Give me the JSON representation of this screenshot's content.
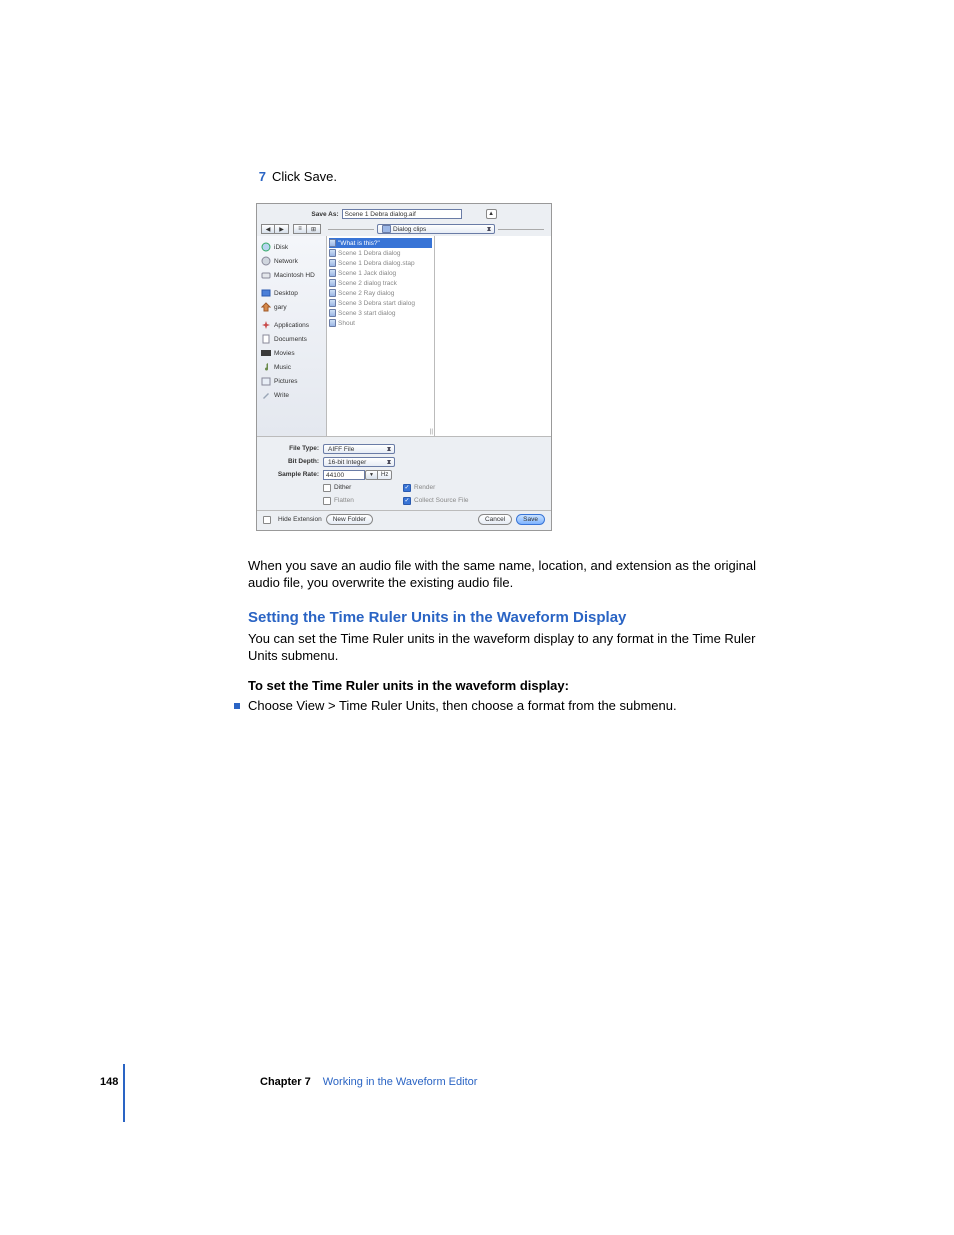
{
  "step": {
    "num": "7",
    "text": "Click Save."
  },
  "dialog": {
    "save_as_label": "Save As:",
    "save_as_value": "Scene 1 Debra dialog.aif",
    "expand_glyph": "▲",
    "nav": {
      "back": "◀",
      "fwd": "▶",
      "view1": "≡",
      "view2": "⊞"
    },
    "location_popup": "Dialog clips",
    "sidebar": [
      {
        "icon": "idisk",
        "label": "iDisk"
      },
      {
        "icon": "network",
        "label": "Network"
      },
      {
        "icon": "hd",
        "label": "Macintosh HD"
      },
      {
        "sep": true
      },
      {
        "icon": "desktop",
        "label": "Desktop"
      },
      {
        "icon": "home",
        "label": "gary"
      },
      {
        "sep": true
      },
      {
        "icon": "apps",
        "label": "Applications"
      },
      {
        "icon": "docs",
        "label": "Documents"
      },
      {
        "icon": "movies",
        "label": "Movies"
      },
      {
        "icon": "music",
        "label": "Music"
      },
      {
        "icon": "pictures",
        "label": "Pictures"
      },
      {
        "icon": "write",
        "label": "Write"
      }
    ],
    "files": [
      {
        "name": "\"What is this?\"",
        "sel": true
      },
      {
        "name": "Scene 1 Debra dialog"
      },
      {
        "name": "Scene 1 Debra dialog.stap"
      },
      {
        "name": "Scene 1 Jack dialog"
      },
      {
        "name": "Scene 2 dialog track"
      },
      {
        "name": "Scene 2 Ray dialog"
      },
      {
        "name": "Scene 3 Debra start dialog"
      },
      {
        "name": "Scene 3 start dialog"
      },
      {
        "name": "Shout"
      }
    ],
    "options": {
      "file_type_label": "File Type:",
      "file_type_value": "AIFF File",
      "bit_depth_label": "Bit Depth:",
      "bit_depth_value": "16-bit Integer",
      "sample_rate_label": "Sample Rate:",
      "sample_rate_value": "44100",
      "hz_glyph": "▼",
      "hz_label": "Hz",
      "dither_label": "Dither",
      "flatten_label": "Flatten",
      "render_label": "Render",
      "collect_label": "Collect Source File"
    },
    "footer": {
      "hide_ext_label": "Hide Extension",
      "new_folder_label": "New Folder",
      "cancel_label": "Cancel",
      "save_label": "Save"
    }
  },
  "body1": "When you save an audio file with the same name, location, and extension as the original audio file, you overwrite the existing audio file.",
  "heading": "Setting the Time Ruler Units in the Waveform Display",
  "body2": "You can set the Time Ruler units in the waveform display to any format in the Time Ruler Units submenu.",
  "subhead": "To set the Time Ruler units in the waveform display:",
  "bullet": "Choose View > Time Ruler Units, then choose a format from the submenu.",
  "footer": {
    "page": "148",
    "chapter_label": "Chapter 7",
    "chapter_title": "Working in the Waveform Editor"
  }
}
